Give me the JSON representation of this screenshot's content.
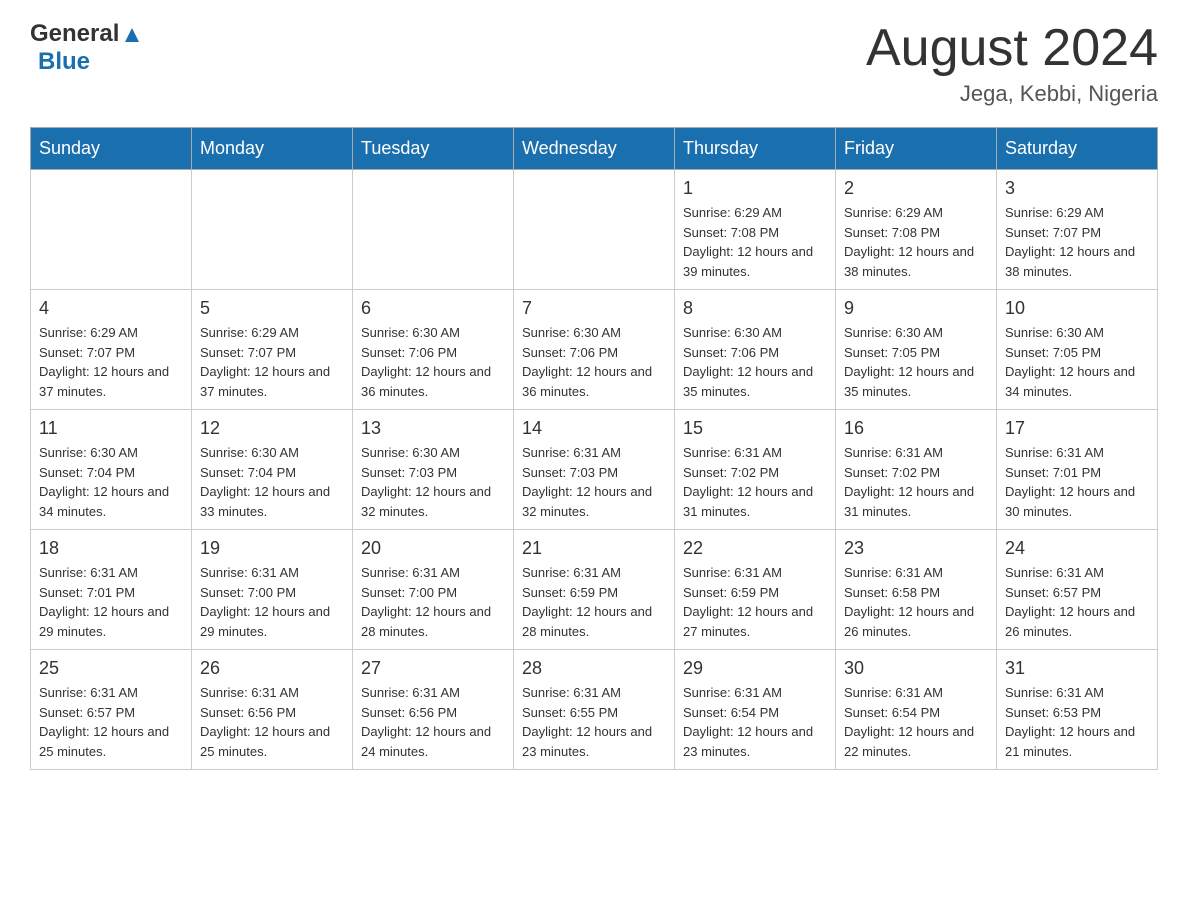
{
  "header": {
    "logo_general": "General",
    "logo_blue": "Blue",
    "title": "August 2024",
    "subtitle": "Jega, Kebbi, Nigeria"
  },
  "weekdays": [
    "Sunday",
    "Monday",
    "Tuesday",
    "Wednesday",
    "Thursday",
    "Friday",
    "Saturday"
  ],
  "weeks": [
    [
      {
        "day": "",
        "info": ""
      },
      {
        "day": "",
        "info": ""
      },
      {
        "day": "",
        "info": ""
      },
      {
        "day": "",
        "info": ""
      },
      {
        "day": "1",
        "info": "Sunrise: 6:29 AM\nSunset: 7:08 PM\nDaylight: 12 hours and 39 minutes."
      },
      {
        "day": "2",
        "info": "Sunrise: 6:29 AM\nSunset: 7:08 PM\nDaylight: 12 hours and 38 minutes."
      },
      {
        "day": "3",
        "info": "Sunrise: 6:29 AM\nSunset: 7:07 PM\nDaylight: 12 hours and 38 minutes."
      }
    ],
    [
      {
        "day": "4",
        "info": "Sunrise: 6:29 AM\nSunset: 7:07 PM\nDaylight: 12 hours and 37 minutes."
      },
      {
        "day": "5",
        "info": "Sunrise: 6:29 AM\nSunset: 7:07 PM\nDaylight: 12 hours and 37 minutes."
      },
      {
        "day": "6",
        "info": "Sunrise: 6:30 AM\nSunset: 7:06 PM\nDaylight: 12 hours and 36 minutes."
      },
      {
        "day": "7",
        "info": "Sunrise: 6:30 AM\nSunset: 7:06 PM\nDaylight: 12 hours and 36 minutes."
      },
      {
        "day": "8",
        "info": "Sunrise: 6:30 AM\nSunset: 7:06 PM\nDaylight: 12 hours and 35 minutes."
      },
      {
        "day": "9",
        "info": "Sunrise: 6:30 AM\nSunset: 7:05 PM\nDaylight: 12 hours and 35 minutes."
      },
      {
        "day": "10",
        "info": "Sunrise: 6:30 AM\nSunset: 7:05 PM\nDaylight: 12 hours and 34 minutes."
      }
    ],
    [
      {
        "day": "11",
        "info": "Sunrise: 6:30 AM\nSunset: 7:04 PM\nDaylight: 12 hours and 34 minutes."
      },
      {
        "day": "12",
        "info": "Sunrise: 6:30 AM\nSunset: 7:04 PM\nDaylight: 12 hours and 33 minutes."
      },
      {
        "day": "13",
        "info": "Sunrise: 6:30 AM\nSunset: 7:03 PM\nDaylight: 12 hours and 32 minutes."
      },
      {
        "day": "14",
        "info": "Sunrise: 6:31 AM\nSunset: 7:03 PM\nDaylight: 12 hours and 32 minutes."
      },
      {
        "day": "15",
        "info": "Sunrise: 6:31 AM\nSunset: 7:02 PM\nDaylight: 12 hours and 31 minutes."
      },
      {
        "day": "16",
        "info": "Sunrise: 6:31 AM\nSunset: 7:02 PM\nDaylight: 12 hours and 31 minutes."
      },
      {
        "day": "17",
        "info": "Sunrise: 6:31 AM\nSunset: 7:01 PM\nDaylight: 12 hours and 30 minutes."
      }
    ],
    [
      {
        "day": "18",
        "info": "Sunrise: 6:31 AM\nSunset: 7:01 PM\nDaylight: 12 hours and 29 minutes."
      },
      {
        "day": "19",
        "info": "Sunrise: 6:31 AM\nSunset: 7:00 PM\nDaylight: 12 hours and 29 minutes."
      },
      {
        "day": "20",
        "info": "Sunrise: 6:31 AM\nSunset: 7:00 PM\nDaylight: 12 hours and 28 minutes."
      },
      {
        "day": "21",
        "info": "Sunrise: 6:31 AM\nSunset: 6:59 PM\nDaylight: 12 hours and 28 minutes."
      },
      {
        "day": "22",
        "info": "Sunrise: 6:31 AM\nSunset: 6:59 PM\nDaylight: 12 hours and 27 minutes."
      },
      {
        "day": "23",
        "info": "Sunrise: 6:31 AM\nSunset: 6:58 PM\nDaylight: 12 hours and 26 minutes."
      },
      {
        "day": "24",
        "info": "Sunrise: 6:31 AM\nSunset: 6:57 PM\nDaylight: 12 hours and 26 minutes."
      }
    ],
    [
      {
        "day": "25",
        "info": "Sunrise: 6:31 AM\nSunset: 6:57 PM\nDaylight: 12 hours and 25 minutes."
      },
      {
        "day": "26",
        "info": "Sunrise: 6:31 AM\nSunset: 6:56 PM\nDaylight: 12 hours and 25 minutes."
      },
      {
        "day": "27",
        "info": "Sunrise: 6:31 AM\nSunset: 6:56 PM\nDaylight: 12 hours and 24 minutes."
      },
      {
        "day": "28",
        "info": "Sunrise: 6:31 AM\nSunset: 6:55 PM\nDaylight: 12 hours and 23 minutes."
      },
      {
        "day": "29",
        "info": "Sunrise: 6:31 AM\nSunset: 6:54 PM\nDaylight: 12 hours and 23 minutes."
      },
      {
        "day": "30",
        "info": "Sunrise: 6:31 AM\nSunset: 6:54 PM\nDaylight: 12 hours and 22 minutes."
      },
      {
        "day": "31",
        "info": "Sunrise: 6:31 AM\nSunset: 6:53 PM\nDaylight: 12 hours and 21 minutes."
      }
    ]
  ]
}
